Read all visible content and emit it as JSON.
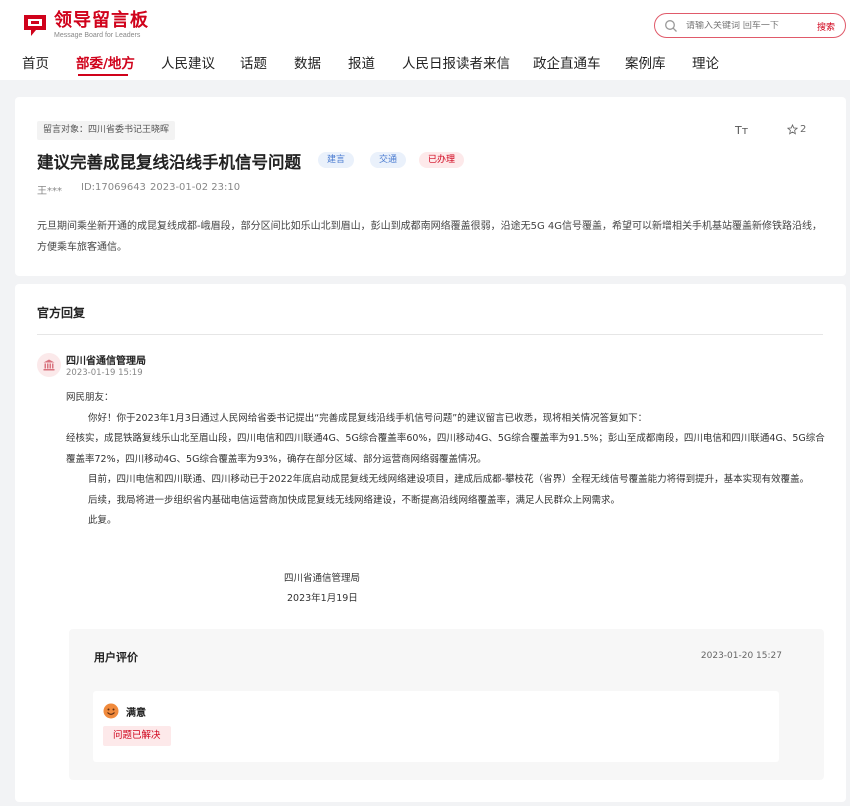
{
  "header": {
    "logo_title": "领导留言板",
    "logo_subtitle": "Message Board for Leaders",
    "search_placeholder": "请输入关键词 回车一下",
    "search_button": "搜索",
    "brand_color": "#d0021b"
  },
  "nav": {
    "items": [
      "首页",
      "部委/地方",
      "人民建议",
      "话题",
      "数据",
      "报道",
      "人民日报读者来信",
      "政企直通车",
      "案例库",
      "理论"
    ],
    "active_index": 1
  },
  "message": {
    "target_label": "留言对象：四川省委书记王晓晖",
    "title": "建议完善成昆复线沿线手机信号问题",
    "tags": [
      "建言",
      "交通",
      "已办理"
    ],
    "author": "王***",
    "id": "ID:17069643",
    "datetime": "2023-01-02 23:10",
    "font_icon": "Tт",
    "star_count": "2",
    "body": "元旦期间乘坐新开通的成昆复线成都-峨眉段，部分区间比如乐山北到眉山，彭山到成都南网络覆盖很弱，沿途无5G 4G信号覆盖，希望可以新增相关手机基站覆盖新修铁路沿线，方便乘车旅客通信。"
  },
  "reply": {
    "section_title": "官方回复",
    "org_name": "四川省通信管理局",
    "org_time": "2023-01-19 15:19",
    "greeting": "网民朋友：",
    "p1": "你好！你于2023年1月3日通过人民网给省委书记提出“完善成昆复线沿线手机信号问题”的建议留言已收悉，现将相关情况答复如下：",
    "p2": "经核实，成昆铁路复线乐山北至眉山段，四川电信和四川联通4G、5G综合覆盖率60%，四川移动4G、5G综合覆盖率为91.5%；彭山至成都南段，四川电信和四川联通4G、5G综合覆盖率72%，四川移动4G、5G综合覆盖率为93%，确存在部分区域、部分运营商网络弱覆盖情况。",
    "p3": "目前，四川电信和四川联通、四川移动已于2022年底启动成昆复线无线网络建设项目，建成后成都-攀枝花（省界）全程无线信号覆盖能力将得到提升，基本实现有效覆盖。",
    "p4": "后续，我局将进一步组织省内基础电信运营商加快成昆复线无线网络建设，不断提高沿线网络覆盖率，满足人民群众上网需求。",
    "p5": "此复。",
    "sign_org": "四川省通信管理局",
    "sign_date": "2023年1月19日"
  },
  "evaluation": {
    "title": "用户评价",
    "time": "2023-01-20 15:27",
    "rating": "满意",
    "status": "问题已解决"
  }
}
